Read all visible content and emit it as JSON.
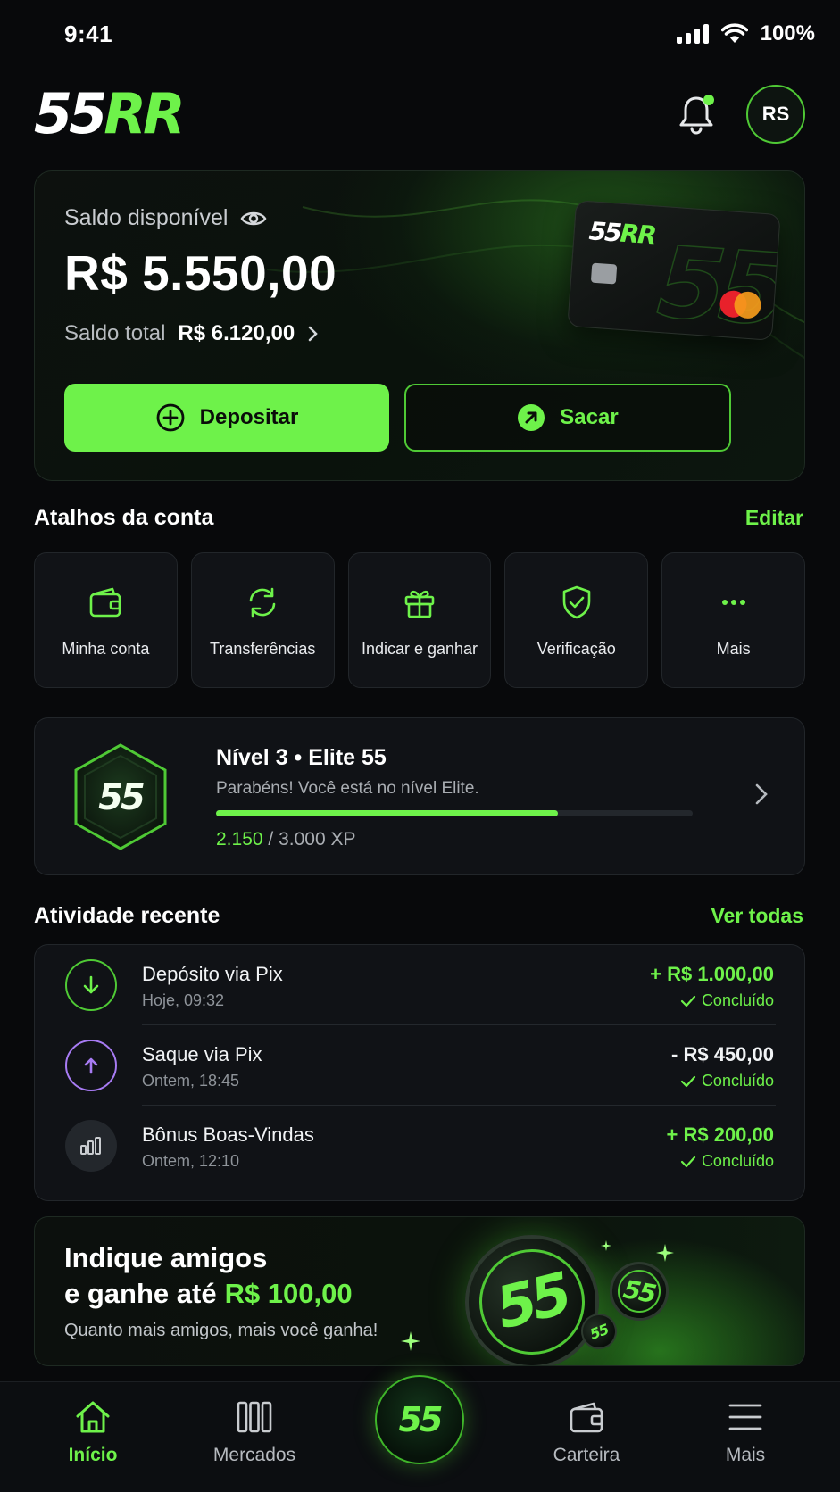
{
  "status_bar": {
    "time": "9:41",
    "battery": "100%"
  },
  "header": {
    "logo_white": "55",
    "logo_green": "RR",
    "avatar_initials": "RS"
  },
  "balance": {
    "label": "Saldo disponível",
    "amount": "R$ 5.550,00",
    "total_label": "Saldo total",
    "total_value": "R$ 6.120,00",
    "card_logo_white": "55",
    "card_logo_green": "RR",
    "card_bg_text": "55",
    "deposit_label": "Depositar",
    "withdraw_label": "Sacar"
  },
  "shortcuts": {
    "title": "Atalhos da conta",
    "edit_label": "Editar",
    "items": [
      {
        "label": "Minha conta",
        "icon": "wallet-icon"
      },
      {
        "label": "Transferências",
        "icon": "refresh-icon"
      },
      {
        "label": "Indicar e ganhar",
        "icon": "gift-icon"
      },
      {
        "label": "Verificação",
        "icon": "shield-check-icon"
      },
      {
        "label": "Mais",
        "icon": "more-icon"
      }
    ]
  },
  "level": {
    "badge": "55",
    "title": "Nível 3 • Elite 55",
    "subtitle": "Parabéns! Você está no nível Elite.",
    "xp_current": "2.150",
    "xp_total": "/ 3.000 XP",
    "progress_fraction": 0.717
  },
  "activity": {
    "title": "Atividade recente",
    "see_all_label": "Ver todas",
    "items": [
      {
        "title": "Depósito via Pix",
        "time": "Hoje, 09:32",
        "amount": "+ R$ 1.000,00",
        "status": "Concluído",
        "icon": "arrow-down-icon"
      },
      {
        "title": "Saque via Pix",
        "time": "Ontem, 18:45",
        "amount": "- R$ 450,00",
        "status": "Concluído",
        "icon": "arrow-up-icon"
      },
      {
        "title": "Bônus Boas-Vindas",
        "time": "Ontem, 12:10",
        "amount": "+ R$ 200,00",
        "status": "Concluído",
        "icon": "chart-icon"
      }
    ]
  },
  "promo": {
    "line1": "Indique amigos",
    "line2_prefix": "e ganhe até",
    "line2_amount": "R$ 100,00",
    "subtitle": "Quanto mais amigos, mais você ganha!",
    "coin_text": "55"
  },
  "bottom_nav": {
    "items": [
      {
        "label": "Início",
        "icon": "home-icon"
      },
      {
        "label": "Mercados",
        "icon": "markets-icon"
      },
      {
        "label": "Carteira",
        "icon": "wallet-icon"
      },
      {
        "label": "Mais",
        "icon": "menu-icon"
      }
    ],
    "center_label": "55"
  },
  "colors": {
    "accent": "#6ef24a",
    "background": "#08090b",
    "card": "#101216",
    "purple": "#a77bf3"
  }
}
